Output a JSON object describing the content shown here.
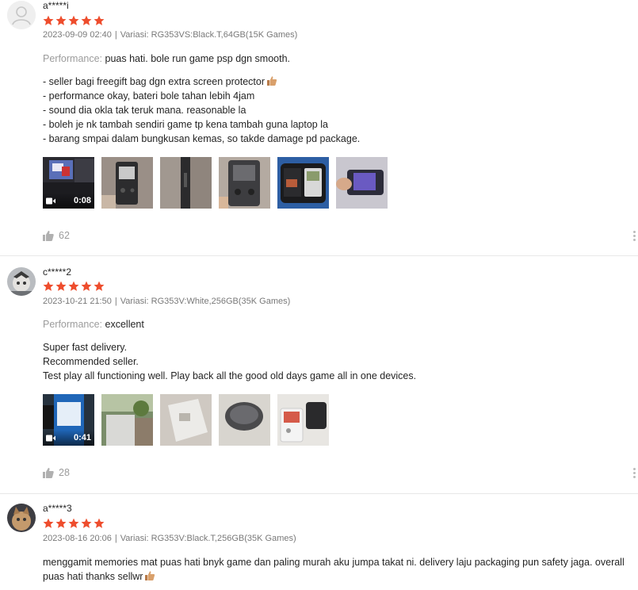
{
  "reviews": [
    {
      "username": "a*****i",
      "rating": 5,
      "date": "2023-09-09 02:40",
      "variation": "Variasi: RG353VS:Black.T,64GB(15K Games)",
      "performance_label": "Performance:",
      "performance_value": "puas hati. bole run game psp dgn smooth.",
      "lines": [
        "- seller bagi freegift bag dgn extra screen protector",
        "- performance okay, bateri bole tahan lebih 4jam",
        "- sound dia okla tak teruk mana. reasonable la",
        "- boleh je nk tambah sendiri game tp kena tambah guna laptop la",
        "- barang smpai dalam bungkusan kemas, so takde damage pd package."
      ],
      "video_duration": "0:08",
      "likes": "62"
    },
    {
      "username": "c*****2",
      "rating": 5,
      "date": "2023-10-21 21:50",
      "variation": "Variasi: RG353V:White,256GB(35K Games)",
      "performance_label": "Performance:",
      "performance_value": "excellent",
      "lines": [
        "Super fast delivery.",
        "Recommended seller.",
        "Test play all functioning well. Play back all the good old days game all in one devices."
      ],
      "video_duration": "0:41",
      "likes": "28"
    },
    {
      "username": "a*****3",
      "rating": 5,
      "date": "2023-08-16 20:06",
      "variation": "Variasi: RG353V:Black.T,256GB(35K Games)",
      "lines": [
        "menggamit memories mat puas hati bnyk game dan paling murah aku jumpa takat ni. delivery laju packaging pun safety jaga. overall",
        "puas hati thanks sellwr"
      ]
    }
  ],
  "colors": {
    "star": "#ee4d2d",
    "muted": "#999999",
    "divider": "#e8e8e8"
  },
  "icons": [
    "user-avatar-icon",
    "star-icon",
    "video-camera-icon",
    "thumbs-up-icon",
    "more-vertical-icon"
  ]
}
